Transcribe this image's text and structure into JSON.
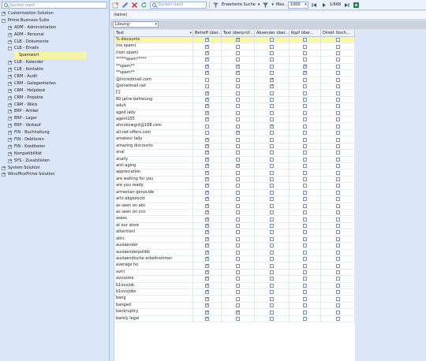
{
  "left": {
    "search_placeholder": "Suchen nach",
    "tree": [
      {
        "label": "Customization Solution",
        "level": 0,
        "expander": "+"
      },
      {
        "label": "Prime Business Suite",
        "level": 0,
        "expander": "−"
      },
      {
        "label": "ADM - Administration",
        "level": 1,
        "expander": "+"
      },
      {
        "label": "ADM - Personal",
        "level": 1,
        "expander": "+"
      },
      {
        "label": "CLB - Dokumente",
        "level": 1,
        "expander": "+"
      },
      {
        "label": "CLB - Emails",
        "level": 1,
        "expander": "−"
      },
      {
        "label": "Spamwort",
        "level": 2,
        "expander": "",
        "selected": true
      },
      {
        "label": "CLB - Kalender",
        "level": 1,
        "expander": "+"
      },
      {
        "label": "CLB - Kontakte",
        "level": 1,
        "expander": "+"
      },
      {
        "label": "CRM - Audit",
        "level": 1,
        "expander": "+"
      },
      {
        "label": "CRM - Gelegenheiten",
        "level": 1,
        "expander": "+"
      },
      {
        "label": "CRM - Helpdesk",
        "level": 1,
        "expander": "+"
      },
      {
        "label": "CRM - Projekte",
        "level": 1,
        "expander": "+"
      },
      {
        "label": "CRM - Wikis",
        "level": 1,
        "expander": "+"
      },
      {
        "label": "ERP - Artikel",
        "level": 1,
        "expander": "+"
      },
      {
        "label": "ERP - Lager",
        "level": 1,
        "expander": "+"
      },
      {
        "label": "ERP - Verkauf",
        "level": 1,
        "expander": "+"
      },
      {
        "label": "FIN - Buchhaltung",
        "level": 1,
        "expander": "+"
      },
      {
        "label": "FIN - Debitoren",
        "level": 1,
        "expander": "+"
      },
      {
        "label": "FIN - Kreditoren",
        "level": 1,
        "expander": "+"
      },
      {
        "label": "Kompatibilität",
        "level": 1,
        "expander": "+"
      },
      {
        "label": "SYS - Zusatzlisten",
        "level": 1,
        "expander": "+"
      },
      {
        "label": "System Solution",
        "level": 0,
        "expander": "+"
      },
      {
        "label": "WinofficePrime Solution",
        "level": 0,
        "expander": "+"
      }
    ]
  },
  "toolbar": {
    "search_placeholder": "Suchen nach",
    "advanced_search_label": "Erweiterte Suche",
    "max_label": "Max.",
    "max_value": "1000",
    "page_indicator": "1/668",
    "icons": [
      "new-record-icon",
      "edit-icon",
      "delete-icon",
      "refresh-icon",
      "filter-icon",
      "first-page-icon",
      "next-page-icon",
      "last-page-icon",
      "excel-export-icon"
    ]
  },
  "filter_bar": {
    "text": "(keine)"
  },
  "grouping": {
    "value": "Lösung"
  },
  "grid": {
    "columns": [
      "Text",
      "Betreff über...",
      "Text überprüf...",
      "Absender über...",
      "Kopf über...",
      "Direkt lösch..."
    ],
    "rows": [
      {
        "text": "% discounts",
        "c": [
          true,
          true,
          false,
          false,
          false
        ],
        "highlight": true
      },
      {
        "text": "(no spam)",
        "c": [
          true,
          false,
          false,
          false,
          false
        ]
      },
      {
        "text": "(non spam)",
        "c": [
          true,
          false,
          false,
          false,
          false
        ]
      },
      {
        "text": "*****spam*****",
        "c": [
          true,
          false,
          false,
          false,
          false
        ]
      },
      {
        "text": "**spam**",
        "c": [
          true,
          true,
          false,
          true,
          false
        ]
      },
      {
        "text": "**spam**",
        "c": [
          true,
          true,
          false,
          true,
          false
        ]
      },
      {
        "text": "@incredimail.com",
        "c": [
          false,
          false,
          true,
          false,
          false
        ]
      },
      {
        "text": "@xinetmail.net",
        "c": [
          false,
          false,
          true,
          false,
          false
        ]
      },
      {
        "text": "[\\]",
        "c": [
          true,
          false,
          false,
          false,
          false
        ]
      },
      {
        "text": "60 jahre befreiung",
        "c": [
          true,
          false,
          false,
          false,
          false
        ]
      },
      {
        "text": "adult",
        "c": [
          true,
          false,
          false,
          false,
          false
        ]
      },
      {
        "text": "aged lady",
        "c": [
          true,
          false,
          false,
          false,
          false
        ]
      },
      {
        "text": "agent155",
        "c": [
          true,
          false,
          false,
          false,
          false
        ]
      },
      {
        "text": "ahnvbvwgnt@168.com",
        "c": [
          false,
          false,
          true,
          false,
          false
        ]
      },
      {
        "text": "all-net-offers.com",
        "c": [
          false,
          true,
          false,
          false,
          false
        ]
      },
      {
        "text": "amateur lady",
        "c": [
          true,
          false,
          false,
          false,
          false
        ]
      },
      {
        "text": "amazing discounts",
        "c": [
          true,
          false,
          false,
          false,
          false
        ]
      },
      {
        "text": "anal",
        "c": [
          true,
          false,
          false,
          false,
          false
        ]
      },
      {
        "text": "anally",
        "c": [
          true,
          false,
          false,
          false,
          false
        ]
      },
      {
        "text": "anti-aging",
        "c": [
          true,
          true,
          false,
          false,
          false
        ]
      },
      {
        "text": "appreciation",
        "c": [
          true,
          false,
          false,
          false,
          false
        ]
      },
      {
        "text": "are waiting for you",
        "c": [
          true,
          false,
          false,
          false,
          false
        ]
      },
      {
        "text": "are you ready",
        "c": [
          true,
          false,
          false,
          false,
          false
        ]
      },
      {
        "text": "armenian genocide",
        "c": [
          true,
          false,
          false,
          false,
          false
        ]
      },
      {
        "text": "artz abgezockt",
        "c": [
          true,
          false,
          false,
          false,
          false
        ]
      },
      {
        "text": "as seen on abc",
        "c": [
          true,
          false,
          false,
          false,
          false
        ]
      },
      {
        "text": "as seen on cnn",
        "c": [
          true,
          false,
          false,
          false,
          false
        ]
      },
      {
        "text": "asess",
        "c": [
          true,
          false,
          false,
          false,
          false
        ]
      },
      {
        "text": "at our store",
        "c": [
          true,
          false,
          false,
          false,
          false
        ]
      },
      {
        "text": "attention!",
        "c": [
          true,
          false,
          false,
          false,
          false
        ]
      },
      {
        "text": "attn:",
        "c": [
          true,
          false,
          false,
          false,
          false
        ]
      },
      {
        "text": "auslaender",
        "c": [
          true,
          false,
          false,
          false,
          false
        ]
      },
      {
        "text": "auslaenderpolitik",
        "c": [
          true,
          false,
          false,
          false,
          false
        ]
      },
      {
        "text": "auslaendische arbeitnehmer",
        "c": [
          true,
          false,
          false,
          false,
          false
        ]
      },
      {
        "text": "average ho",
        "c": [
          true,
          false,
          false,
          false,
          false
        ]
      },
      {
        "text": "avril",
        "c": [
          true,
          false,
          false,
          false,
          false
        ]
      },
      {
        "text": "avvsome",
        "c": [
          true,
          false,
          false,
          false,
          false
        ]
      },
      {
        "text": "b1ovvjob",
        "c": [
          true,
          false,
          false,
          false,
          false
        ]
      },
      {
        "text": "b1ovvjobs",
        "c": [
          true,
          false,
          false,
          false,
          false
        ]
      },
      {
        "text": "bang",
        "c": [
          true,
          false,
          false,
          false,
          false
        ]
      },
      {
        "text": "banged",
        "c": [
          true,
          false,
          false,
          false,
          false
        ]
      },
      {
        "text": "bankruptcy",
        "c": [
          true,
          true,
          false,
          false,
          false
        ]
      },
      {
        "text": "barely legal",
        "c": [
          true,
          false,
          false,
          false,
          false
        ]
      }
    ]
  }
}
